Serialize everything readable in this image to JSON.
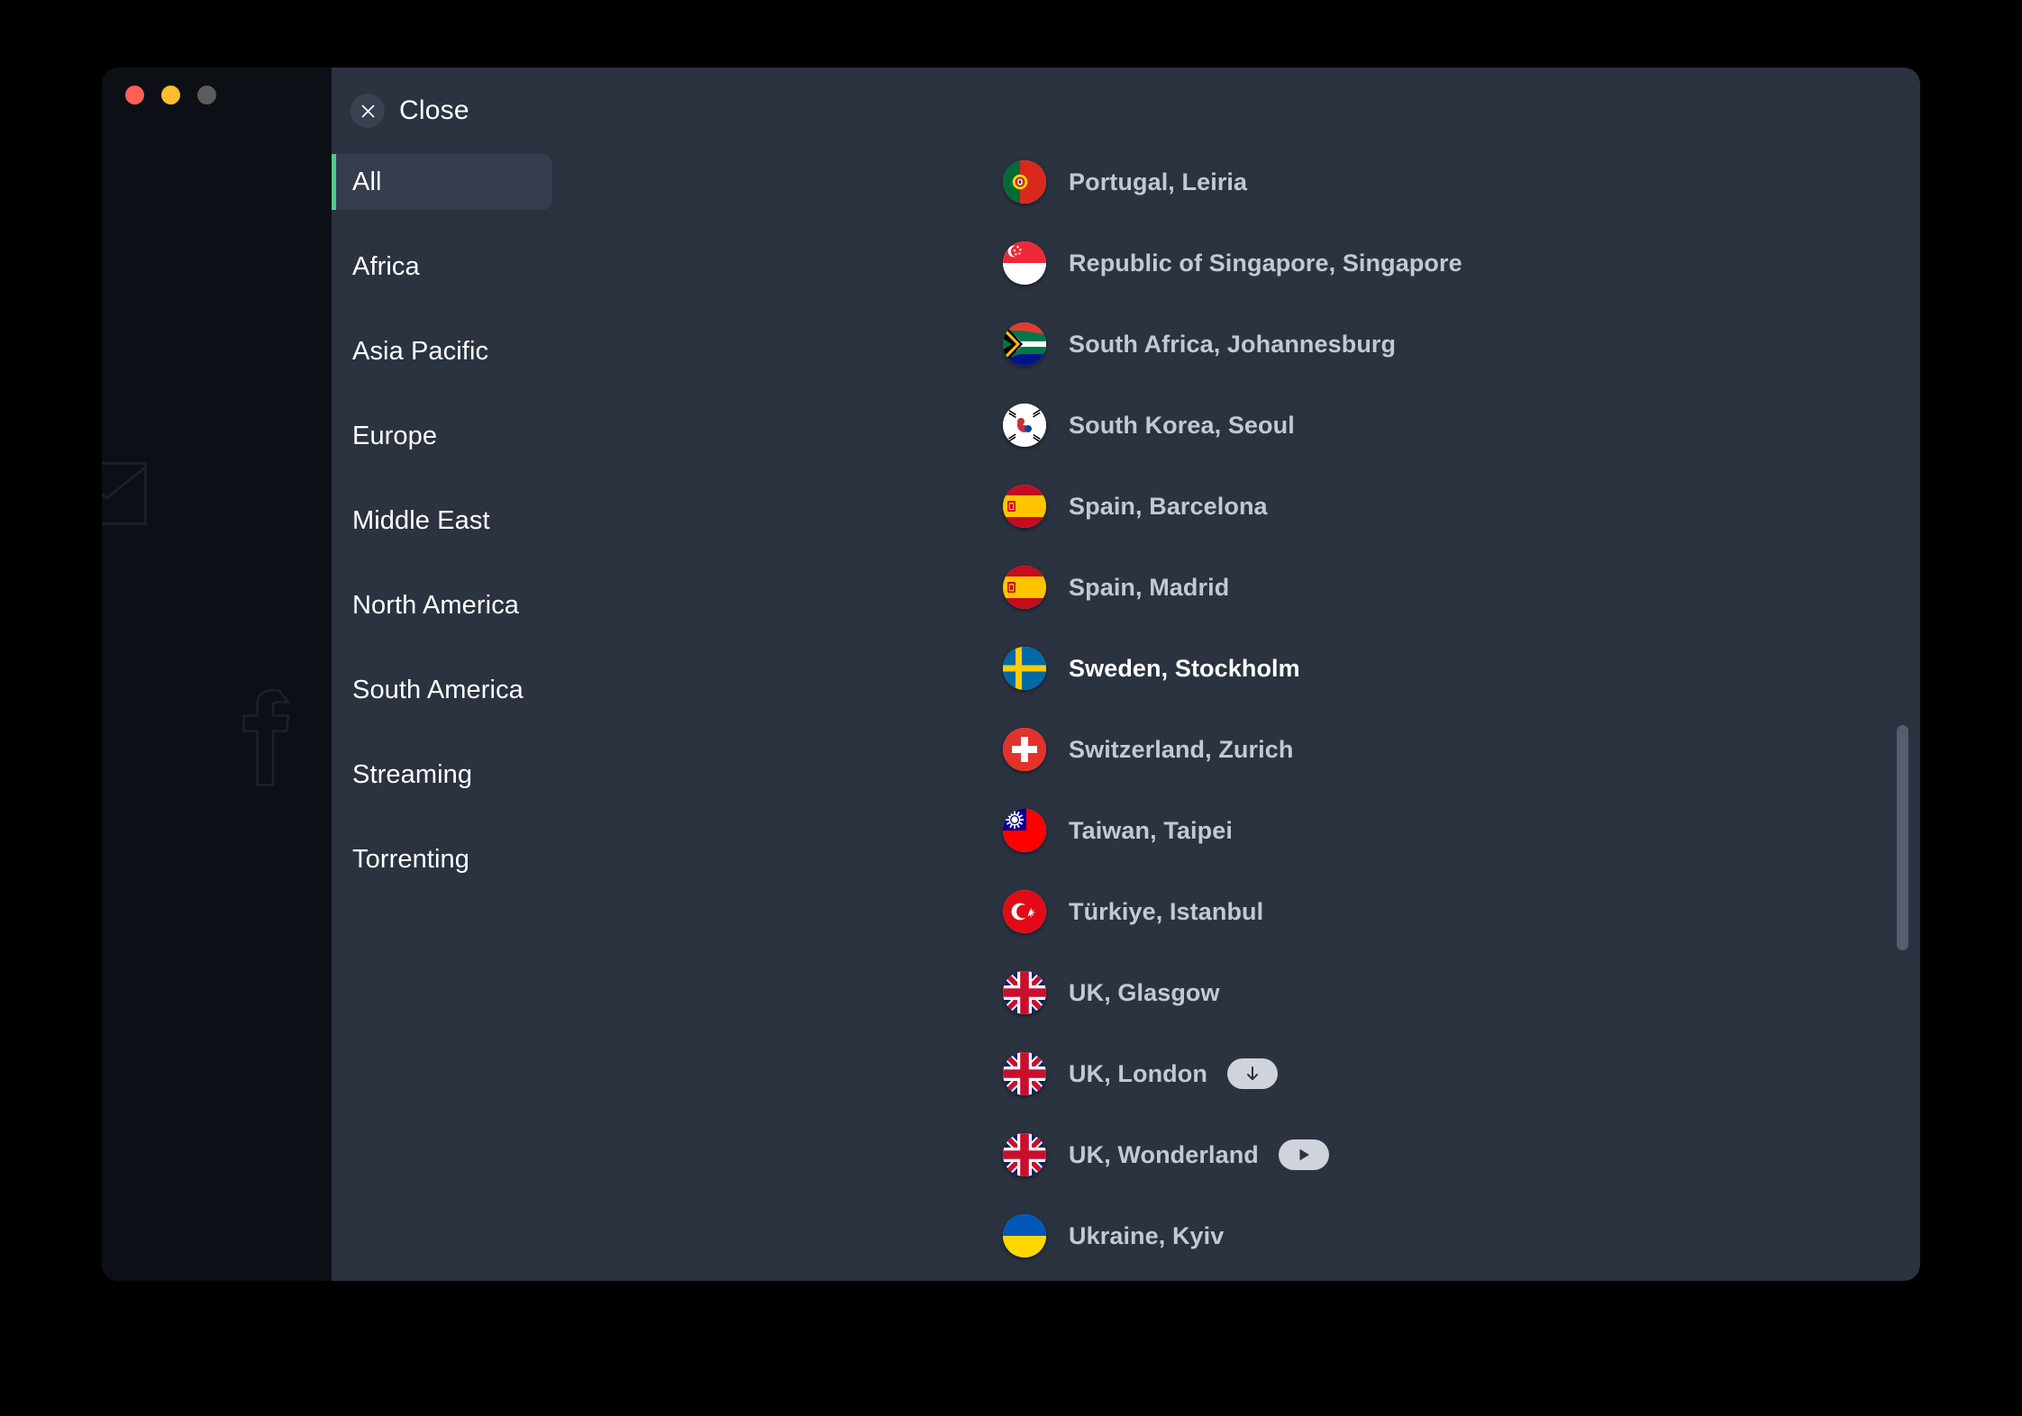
{
  "window": {
    "traffic_lights": [
      {
        "name": "close",
        "color": "#ff5f57"
      },
      {
        "name": "minimize",
        "color": "#ffbd2e"
      },
      {
        "name": "zoom",
        "color": "#5c5c5c"
      }
    ],
    "social_icons": [
      "mail-icon",
      "twitter-icon",
      "facebook-icon"
    ]
  },
  "overlay": {
    "close_label": "Close",
    "accent_color": "#4ecb8d",
    "panel_color": "#2b3240",
    "active_row_color": "#363e4d"
  },
  "categories": [
    {
      "label": "All",
      "active": true
    },
    {
      "label": "Africa",
      "active": false
    },
    {
      "label": "Asia Pacific",
      "active": false
    },
    {
      "label": "Europe",
      "active": false
    },
    {
      "label": "Middle East",
      "active": false
    },
    {
      "label": "North America",
      "active": false
    },
    {
      "label": "South America",
      "active": false
    },
    {
      "label": "Streaming",
      "active": false
    },
    {
      "label": "Torrenting",
      "active": false
    }
  ],
  "servers": [
    {
      "label": "Portugal, Leiria",
      "flag": "flag-portugal",
      "badge": null,
      "highlight": false
    },
    {
      "label": "Republic of Singapore, Singapore",
      "flag": "flag-singapore",
      "badge": null,
      "highlight": false
    },
    {
      "label": "South Africa, Johannesburg",
      "flag": "flag-south-africa",
      "badge": null,
      "highlight": false
    },
    {
      "label": "South Korea, Seoul",
      "flag": "flag-south-korea",
      "badge": null,
      "highlight": false
    },
    {
      "label": "Spain, Barcelona",
      "flag": "flag-spain",
      "badge": null,
      "highlight": false
    },
    {
      "label": "Spain, Madrid",
      "flag": "flag-spain",
      "badge": null,
      "highlight": false
    },
    {
      "label": "Sweden, Stockholm",
      "flag": "flag-sweden",
      "badge": null,
      "highlight": true
    },
    {
      "label": "Switzerland, Zurich",
      "flag": "flag-switzerland",
      "badge": null,
      "highlight": false
    },
    {
      "label": "Taiwan, Taipei",
      "flag": "flag-taiwan",
      "badge": null,
      "highlight": false
    },
    {
      "label": "Türkiye, Istanbul",
      "flag": "flag-turkiye",
      "badge": null,
      "highlight": false
    },
    {
      "label": "UK, Glasgow",
      "flag": "flag-uk",
      "badge": null,
      "highlight": false
    },
    {
      "label": "UK, London",
      "flag": "flag-uk",
      "badge": "download-icon",
      "highlight": false
    },
    {
      "label": "UK, Wonderland",
      "flag": "flag-uk",
      "badge": "play-icon",
      "highlight": false
    },
    {
      "label": "Ukraine, Kyiv",
      "flag": "flag-ukraine",
      "badge": null,
      "highlight": false
    }
  ]
}
